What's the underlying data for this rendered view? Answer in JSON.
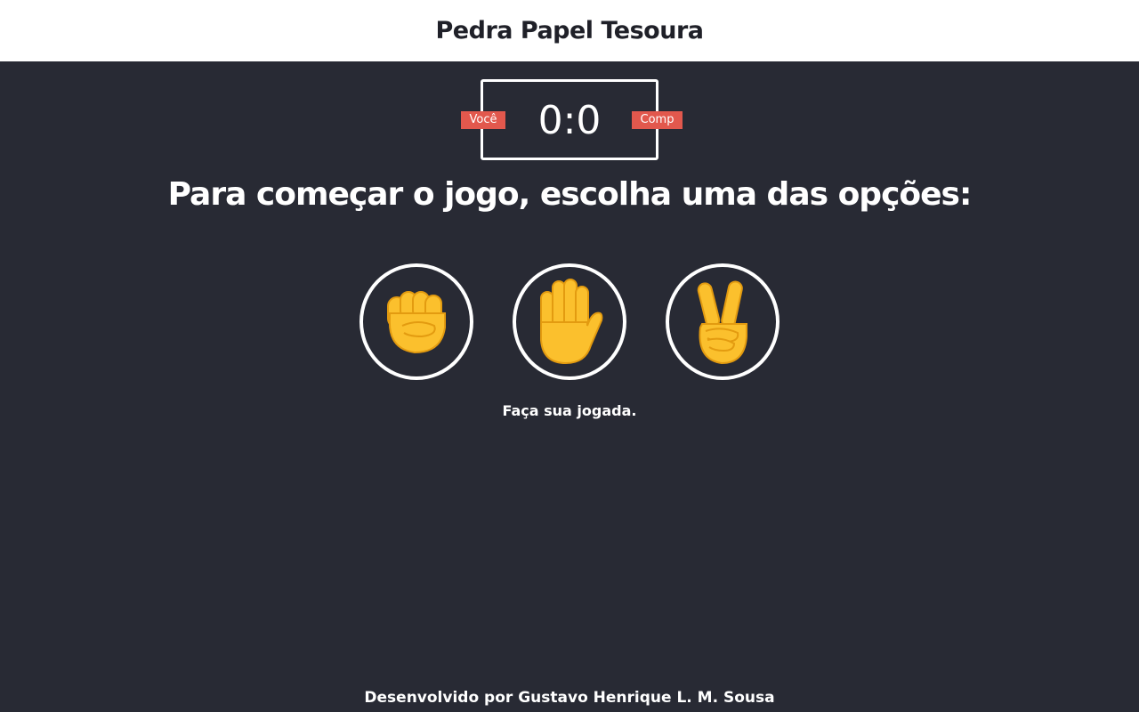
{
  "header": {
    "title": "Pedra Papel Tesoura"
  },
  "scoreboard": {
    "score": "0:0",
    "user_label": "Você",
    "computer_label": "Comp"
  },
  "prompt": "Para começar o jogo, escolha uma das opções:",
  "choices": [
    {
      "icon": "raised-fist-icon"
    },
    {
      "icon": "raised-hand-icon"
    },
    {
      "icon": "victory-hand-icon"
    }
  ],
  "message": "Faça sua jogada.",
  "footer": {
    "credit": "Desenvolvido por Gustavo Henrique L. M. Sousa"
  },
  "colors": {
    "background": "#282a34",
    "header_background": "#ffffff",
    "badge": "#e2584d",
    "emoji_yellow": "#fbc02d"
  }
}
